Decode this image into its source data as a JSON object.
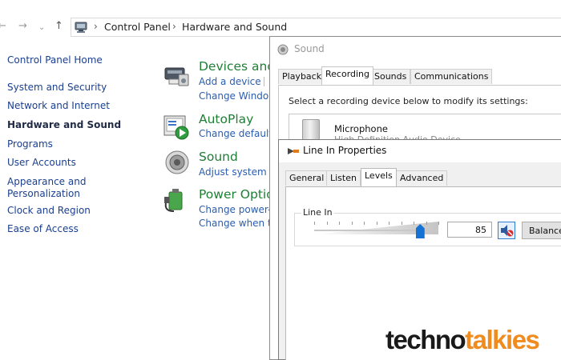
{
  "nav": {
    "back_icon": "arrow-left-icon",
    "forward_icon": "arrow-right-icon",
    "recent_icon": "chevron-down-icon",
    "up_icon": "arrow-up-icon"
  },
  "address_bar": {
    "breadcrumbs": [
      "Control Panel",
      "Hardware and Sound"
    ]
  },
  "left_nav": {
    "items": [
      "Control Panel Home",
      "System and Security",
      "Network and Internet",
      "Hardware and Sound",
      "Programs",
      "User Accounts",
      "Appearance and",
      "Personalization",
      "Clock and Region",
      "Ease of Access"
    ],
    "active": "Hardware and Sound"
  },
  "categories": [
    {
      "title": "Devices and",
      "links": [
        "Add a device",
        "Change Window"
      ]
    },
    {
      "title": "AutoPlay",
      "links": [
        "Change default"
      ]
    },
    {
      "title": "Sound",
      "links": [
        "Adjust system vo"
      ]
    },
    {
      "title": "Power Optio",
      "links": [
        "Change power-s",
        "Change when th"
      ]
    }
  ],
  "sound_dialog": {
    "title": "Sound",
    "tabs": [
      "Playback",
      "Recording",
      "Sounds",
      "Communications"
    ],
    "active_tab": "Recording",
    "instruction": "Select a recording device below to modify its settings:",
    "devices": [
      {
        "name": "Microphone",
        "subtitle": "High Definition Audio Device"
      }
    ]
  },
  "line_in_dialog": {
    "title": "Line In Properties",
    "tabs": [
      "General",
      "Listen",
      "Levels",
      "Advanced"
    ],
    "active_tab": "Levels",
    "group_label": "Line In",
    "level_value": "85",
    "level": 85,
    "balance_label": "Balance"
  },
  "watermark": {
    "part1": "techno",
    "part2": "talkies"
  },
  "colors": {
    "category_title": "#1e7f35",
    "link": "#2a5db0",
    "nav_link": "#1a3f8f",
    "slider_thumb": "#1673d3",
    "watermark_dark": "#1a1a1a",
    "watermark_accent": "#f08c1f"
  }
}
